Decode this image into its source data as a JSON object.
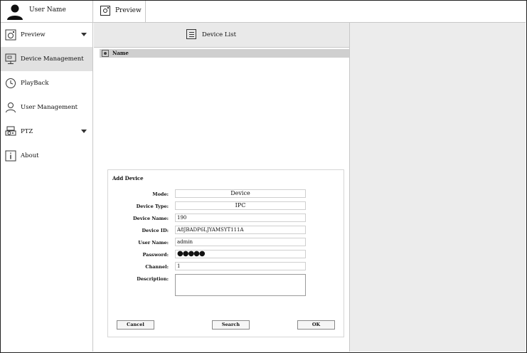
{
  "header": {
    "user_name": "User Name",
    "tab_label": "Preview"
  },
  "sidebar": {
    "items": [
      {
        "label": "Preview",
        "icon": "camera-icon",
        "has_caret": true
      },
      {
        "label": "Device Management",
        "icon": "monitor-icon",
        "active": true
      },
      {
        "label": "PlayBack",
        "icon": "clock-icon"
      },
      {
        "label": "User Management",
        "icon": "user-icon"
      },
      {
        "label": "PTZ",
        "icon": "ptz-camera-icon",
        "has_caret": true
      },
      {
        "label": "About",
        "icon": "info-icon"
      }
    ]
  },
  "device_list": {
    "title": "Device List",
    "column_name": "Name"
  },
  "add_device": {
    "title": "Add Device",
    "fields": {
      "mode": {
        "label": "Mode:",
        "value": "Device"
      },
      "device_type": {
        "label": "Device Type:",
        "value": "IPC"
      },
      "device_name": {
        "label": "Device Name:",
        "value": "190"
      },
      "device_id": {
        "label": "Device ID:",
        "value": "A8JBADP6LJYAMSYT111A"
      },
      "user_name": {
        "label": "User Name:",
        "value": "admin"
      },
      "password": {
        "label": "Password:",
        "value": "●●●●●"
      },
      "channel": {
        "label": "Channel:",
        "value": "1"
      },
      "description": {
        "label": "Description:",
        "value": ""
      }
    },
    "buttons": {
      "cancel": "Cancel",
      "search": "Search",
      "ok": "OK"
    }
  },
  "colors": {
    "active_item": "#e1e1e1",
    "panel_header": "#e9e9e9",
    "right_area": "#ececec"
  }
}
